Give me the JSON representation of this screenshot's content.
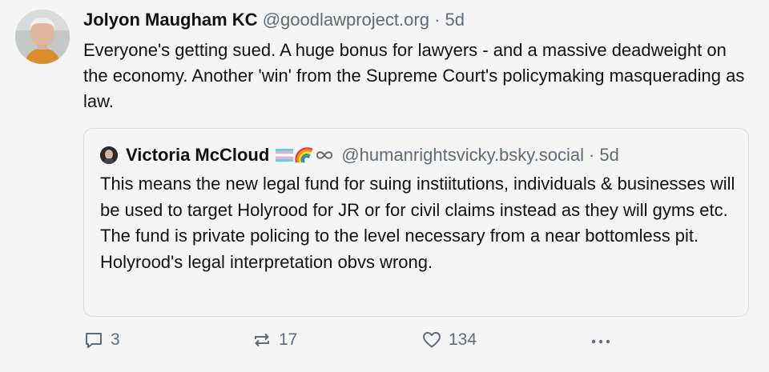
{
  "post": {
    "author_name": "Jolyon Maugham KC",
    "handle": "@goodlawproject.org",
    "separator": "·",
    "time": "5d",
    "text": "Everyone's getting sued. A huge bonus for lawyers - and a massive deadweight on the economy. Another 'win' from the Supreme Court's policymaking masquerading as law."
  },
  "quote": {
    "author_name": "Victoria McCloud",
    "handle": "@humanrightsvicky.bsky.social",
    "separator": "·",
    "time": "5d",
    "text": "This  means the new legal fund for suing instiitutions, individuals & businesses will be used to target Holyrood for JR or for civil claims instead as they will gyms etc. The fund is  private policing to the level necessary from a near bottomless pit. Holyrood's legal interpretation obvs wrong."
  },
  "actions": {
    "replies": "3",
    "reposts": "17",
    "likes": "134"
  },
  "icons": {
    "reply": "reply-icon",
    "repost": "repost-icon",
    "like": "heart-icon",
    "more": "more-icon",
    "badges": [
      "trans-flag-icon",
      "rainbow-icon",
      "infinity-icon"
    ]
  },
  "colors": {
    "background": "#f5f5f5",
    "muted": "#5f6b78",
    "border": "#d7dce1"
  }
}
